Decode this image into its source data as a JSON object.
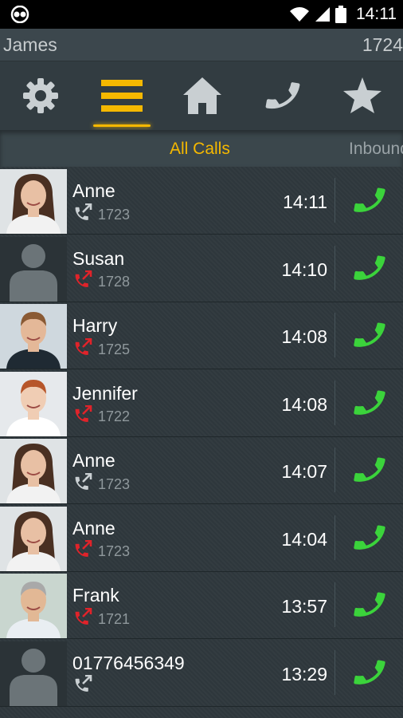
{
  "status_bar": {
    "time": "14:11"
  },
  "user": {
    "name": "James",
    "extension": "1724"
  },
  "toolbar": {
    "items": [
      {
        "icon": "gear-icon",
        "active": false
      },
      {
        "icon": "menu-icon",
        "active": true
      },
      {
        "icon": "home-icon",
        "active": false
      },
      {
        "icon": "phone-icon",
        "active": false
      },
      {
        "icon": "star-icon",
        "active": false
      }
    ]
  },
  "tabs": {
    "active": "All Calls",
    "next": "Inbound"
  },
  "colors": {
    "accent": "#f5b800",
    "missed": "#e0232a",
    "outgoing": "#c9cfd2",
    "call_green": "#3bd33b"
  },
  "calls": [
    {
      "name": "Anne",
      "ext": "1723",
      "time": "14:11",
      "direction": "outgoing",
      "avatar": "anne-photo"
    },
    {
      "name": "Susan",
      "ext": "1728",
      "time": "14:10",
      "direction": "missed",
      "avatar": "placeholder"
    },
    {
      "name": "Harry",
      "ext": "1725",
      "time": "14:08",
      "direction": "missed",
      "avatar": "harry-photo"
    },
    {
      "name": "Jennifer",
      "ext": "1722",
      "time": "14:08",
      "direction": "missed",
      "avatar": "jennifer-photo"
    },
    {
      "name": "Anne",
      "ext": "1723",
      "time": "14:07",
      "direction": "outgoing",
      "avatar": "anne-photo"
    },
    {
      "name": "Anne",
      "ext": "1723",
      "time": "14:04",
      "direction": "missed",
      "avatar": "anne-photo"
    },
    {
      "name": "Frank",
      "ext": "1721",
      "time": "13:57",
      "direction": "missed",
      "avatar": "frank-photo"
    },
    {
      "name": "01776456349",
      "ext": "",
      "time": "13:29",
      "direction": "outgoing",
      "avatar": "placeholder"
    }
  ]
}
